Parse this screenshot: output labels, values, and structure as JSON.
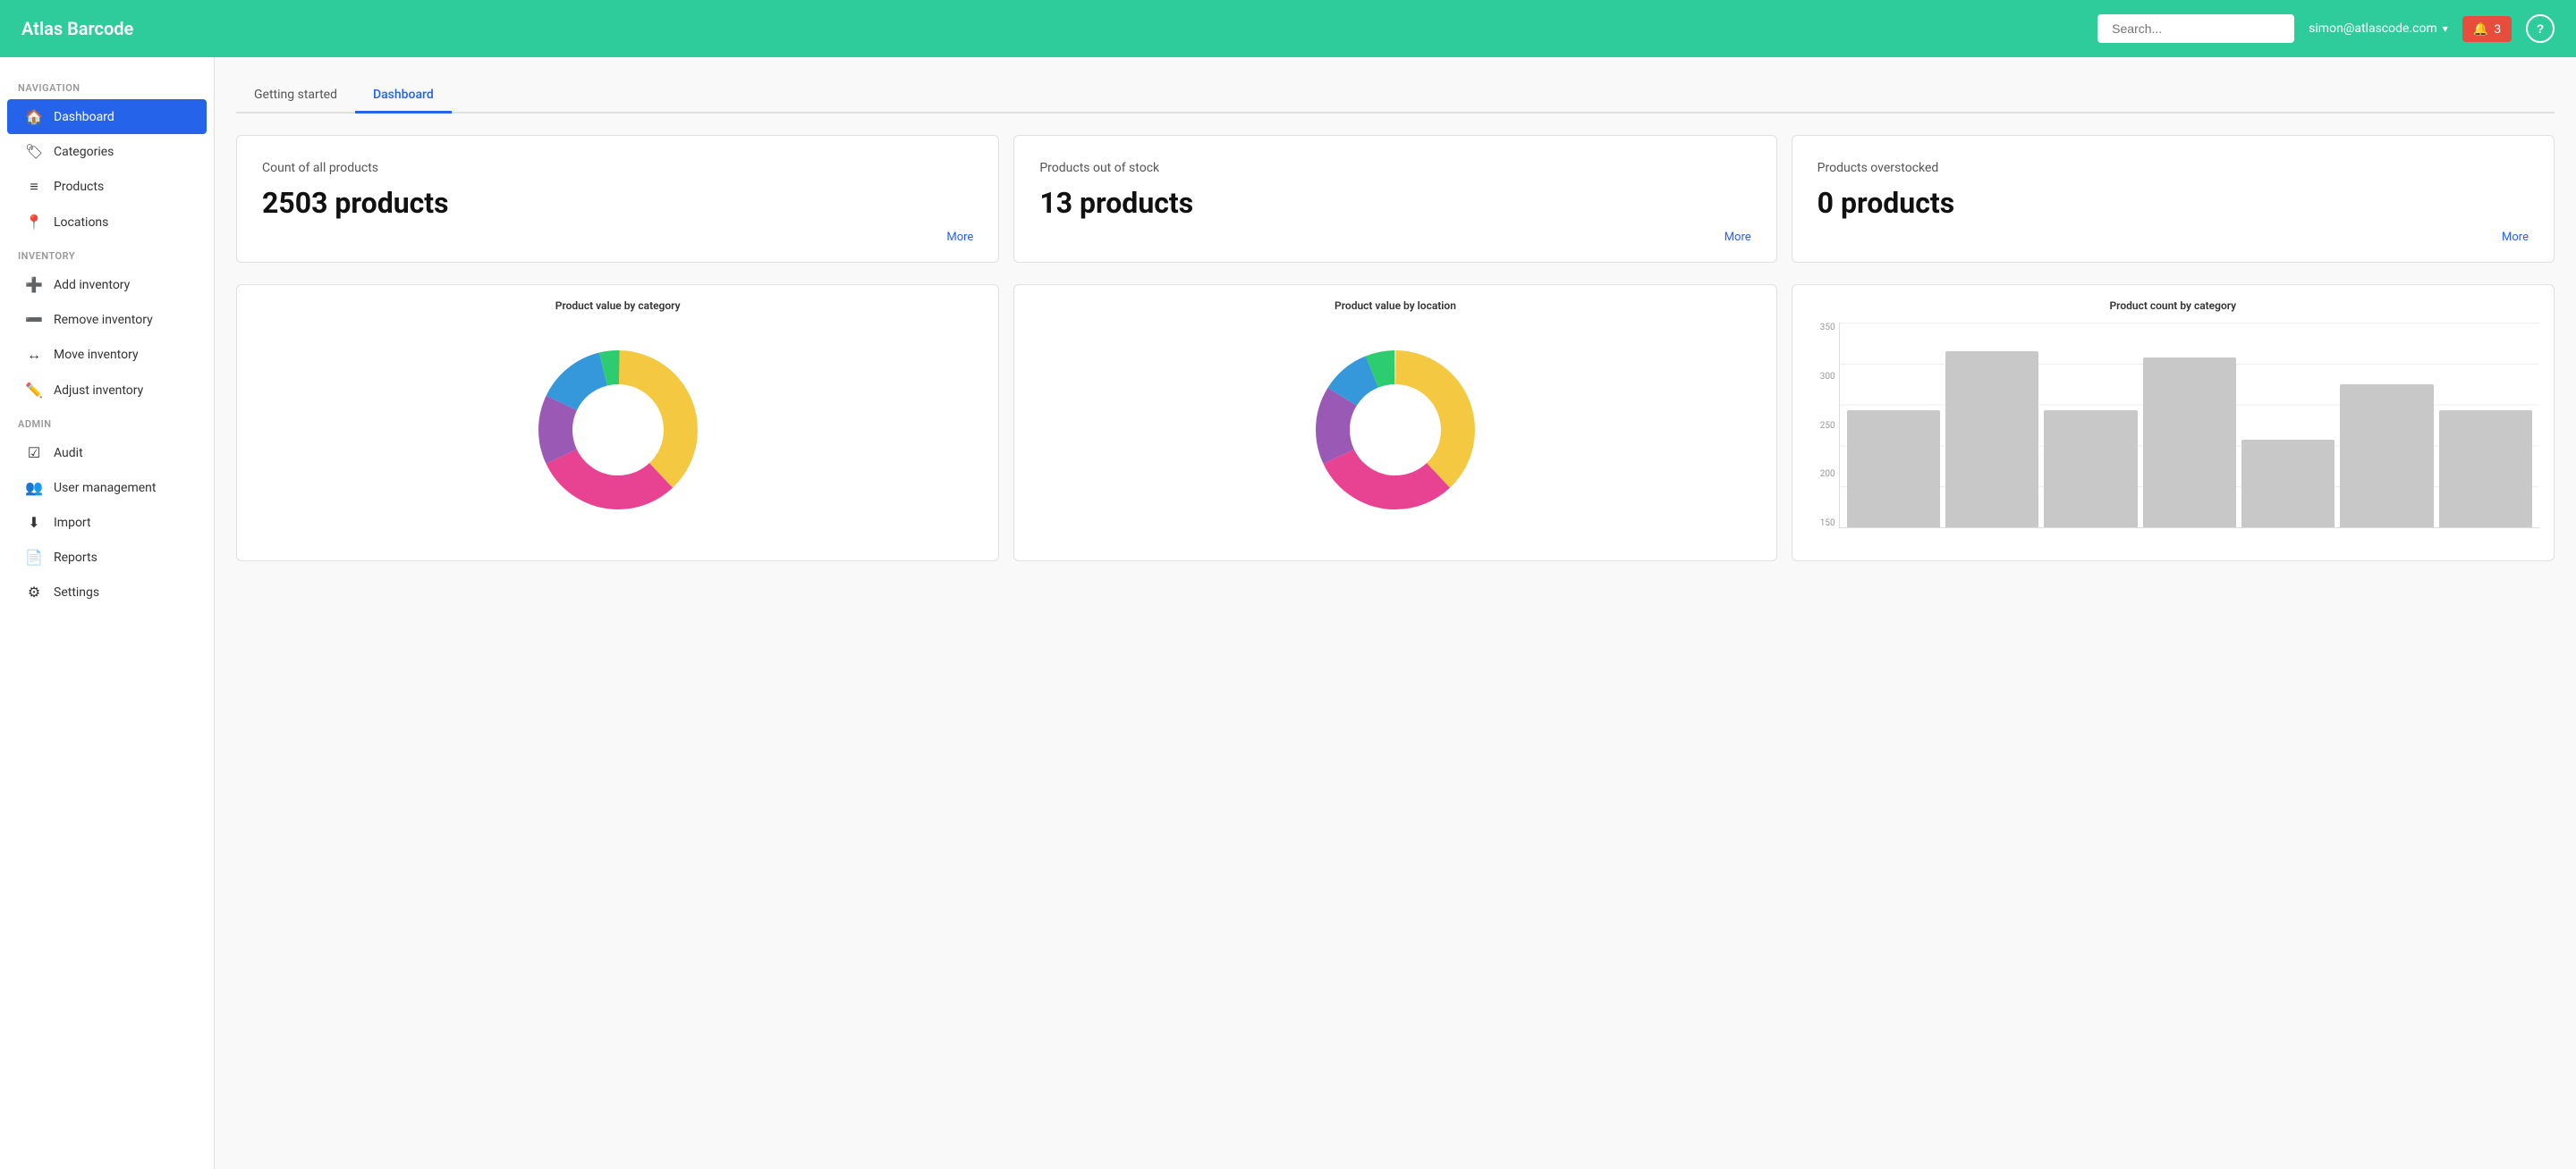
{
  "app": {
    "name": "Atlas Barcode"
  },
  "header": {
    "search_placeholder": "Search...",
    "user_email": "simon@atlascode.com",
    "notif_count": "3",
    "help_label": "?"
  },
  "sidebar": {
    "nav_label": "NAVIGATION",
    "inventory_label": "INVENTORY",
    "admin_label": "ADMIN",
    "items": [
      {
        "id": "dashboard",
        "label": "Dashboard",
        "icon": "🏠",
        "active": true
      },
      {
        "id": "categories",
        "label": "Categories",
        "icon": "🏷",
        "active": false
      },
      {
        "id": "products",
        "label": "Products",
        "icon": "≡",
        "active": false
      },
      {
        "id": "locations",
        "label": "Locations",
        "icon": "📍",
        "active": false
      }
    ],
    "inventory_items": [
      {
        "id": "add-inventory",
        "label": "Add inventory",
        "icon": "+"
      },
      {
        "id": "remove-inventory",
        "label": "Remove inventory",
        "icon": "−"
      },
      {
        "id": "move-inventory",
        "label": "Move inventory",
        "icon": "↔"
      },
      {
        "id": "adjust-inventory",
        "label": "Adjust inventory",
        "icon": "✎"
      }
    ],
    "admin_items": [
      {
        "id": "audit",
        "label": "Audit",
        "icon": "✔"
      },
      {
        "id": "user-management",
        "label": "User management",
        "icon": "👥"
      },
      {
        "id": "import",
        "label": "Import",
        "icon": "⬇"
      },
      {
        "id": "reports",
        "label": "Reports",
        "icon": "📄"
      },
      {
        "id": "settings",
        "label": "Settings",
        "icon": "⚙"
      }
    ]
  },
  "tabs": [
    {
      "id": "getting-started",
      "label": "Getting started",
      "active": false
    },
    {
      "id": "dashboard",
      "label": "Dashboard",
      "active": true
    }
  ],
  "stats": [
    {
      "id": "all-products",
      "label": "Count of all products",
      "value": "2503 products",
      "more_label": "More"
    },
    {
      "id": "out-of-stock",
      "label": "Products out of stock",
      "value": "13 products",
      "more_label": "More"
    },
    {
      "id": "overstocked",
      "label": "Products overstocked",
      "value": "0 products",
      "more_label": "More"
    }
  ],
  "charts": [
    {
      "id": "value-by-category",
      "title": "Product value by category",
      "type": "donut",
      "segments": [
        {
          "color": "#f5c842",
          "percent": 38
        },
        {
          "color": "#e84393",
          "percent": 30
        },
        {
          "color": "#9b59b6",
          "percent": 14
        },
        {
          "color": "#3498db",
          "percent": 14
        },
        {
          "color": "#2ecc71",
          "percent": 4
        }
      ]
    },
    {
      "id": "value-by-location",
      "title": "Product value by location",
      "type": "donut",
      "segments": [
        {
          "color": "#f5c842",
          "percent": 38
        },
        {
          "color": "#e84393",
          "percent": 30
        },
        {
          "color": "#9b59b6",
          "percent": 16
        },
        {
          "color": "#3498db",
          "percent": 10
        },
        {
          "color": "#2ecc71",
          "percent": 6
        }
      ]
    },
    {
      "id": "count-by-category",
      "title": "Product count by category",
      "type": "bar",
      "y_labels": [
        "350",
        "300",
        "250",
        "200",
        "150"
      ],
      "bars": [
        {
          "height_pct": 57,
          "label": ""
        },
        {
          "height_pct": 86,
          "label": ""
        },
        {
          "height_pct": 57,
          "label": ""
        },
        {
          "height_pct": 83,
          "label": ""
        },
        {
          "height_pct": 43,
          "label": ""
        },
        {
          "height_pct": 70,
          "label": ""
        },
        {
          "height_pct": 57,
          "label": ""
        }
      ]
    }
  ]
}
